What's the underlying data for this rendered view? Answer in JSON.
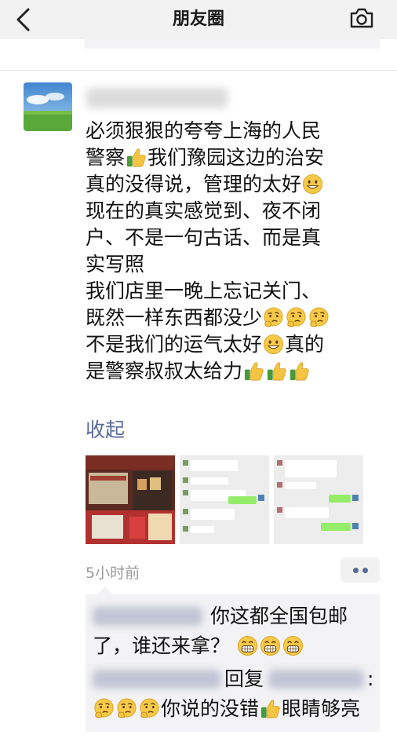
{
  "nav": {
    "title": "朋友圈"
  },
  "post": {
    "text_lines": [
      {
        "segments": [
          "必须狠狠的夸夸上海的人民"
        ]
      },
      {
        "segments": [
          "警察",
          "{thumbs}",
          "我们豫园这边的治安"
        ]
      },
      {
        "segments": [
          "真的没得说，管理的太好",
          "{smile}"
        ]
      },
      {
        "segments": [
          "现在的真实感觉到、夜不闭"
        ]
      },
      {
        "segments": [
          "户、不是一句古话、而是真"
        ]
      },
      {
        "segments": [
          "实写照"
        ]
      },
      {
        "segments": [
          "我们店里一晚上忘记关门、"
        ]
      },
      {
        "segments": [
          "既然一样东西都没少",
          "{think}",
          "{think}",
          "{think}"
        ]
      },
      {
        "segments": [
          "不是我们的运气太好",
          "{smile}",
          "真的"
        ]
      },
      {
        "segments": [
          "是警察叔叔太给力",
          "{thumbs}",
          "{thumbs}",
          "{thumbs}"
        ]
      }
    ],
    "collapse_label": "收起",
    "timestamp": "5小时前",
    "photos": [
      "shop-photo",
      "chat-screenshot-1",
      "chat-screenshot-2"
    ]
  },
  "comments": {
    "first": {
      "text_a": "你这都全国包邮",
      "text_b": "了，谁还来拿？"
    },
    "second": {
      "reply_word": "回复",
      "colon": ":",
      "text": "你说的没错",
      "text_tail": "眼睛够亮"
    }
  },
  "colors": {
    "link": "#586a96",
    "nav_bg": "#f2f2f2",
    "comment_bg": "#f3f3f5"
  },
  "icons": {
    "back": "chevron-left-icon",
    "camera": "camera-icon",
    "more": "more-dots-icon"
  }
}
